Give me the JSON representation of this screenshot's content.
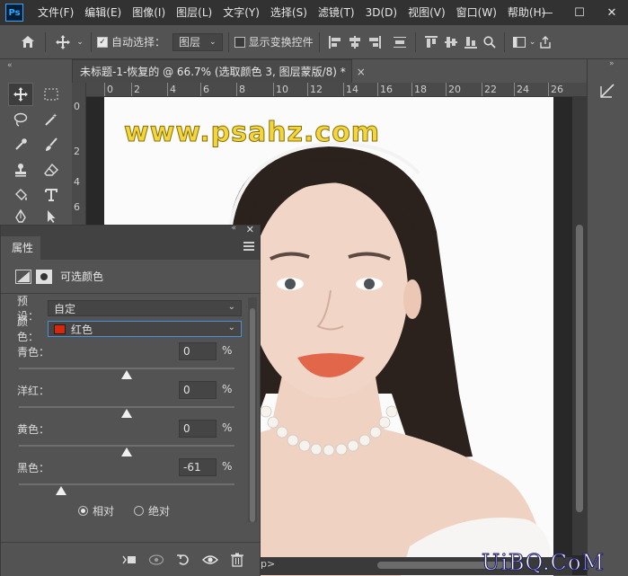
{
  "app": {
    "logo_text": "Ps",
    "menus": [
      "文件(F)",
      "编辑(E)",
      "图像(I)",
      "图层(L)",
      "文字(Y)",
      "选择(S)",
      "滤镜(T)",
      "3D(D)",
      "视图(V)",
      "窗口(W)",
      "帮助(H)"
    ],
    "window_controls": {
      "minimize": "—",
      "maximize": "☐",
      "close": "✕"
    }
  },
  "options_bar": {
    "auto_select_label": "自动选择：",
    "auto_select_checked": true,
    "auto_select_target": "图层",
    "show_transform_label": "显示变换控件",
    "show_transform_checked": false
  },
  "document": {
    "tab_title": "未标题-1-恢复的 @ 66.7% (选取颜色 3, 图层蒙版/8) *",
    "close_glyph": "×",
    "ruler_h_ticks": [
      "0",
      "2",
      "4",
      "6",
      "8",
      "10",
      "12",
      "14",
      "16",
      "18",
      "20",
      "22",
      "24",
      "26"
    ],
    "ruler_v_ticks": [
      "0",
      "2",
      "4",
      "6"
    ],
    "watermark_text": "www.psahz.com",
    "status_fragment": "p>"
  },
  "properties_panel": {
    "tab_label": "属性",
    "title": "可选颜色",
    "preset_label": "预设：",
    "preset_value": "自定",
    "color_label": "颜色：",
    "color_value": "红色",
    "color_swatch": "#d7280b",
    "sliders": [
      {
        "label": "青色：",
        "value": "0",
        "unit": "%",
        "percent": 0
      },
      {
        "label": "洋红：",
        "value": "0",
        "unit": "%",
        "percent": 0
      },
      {
        "label": "黄色：",
        "value": "0",
        "unit": "%",
        "percent": 0
      },
      {
        "label": "黑色：",
        "value": "-61",
        "unit": "%",
        "percent": -61
      }
    ],
    "method_relative": "相对",
    "method_absolute": "绝对",
    "method_selected": "relative"
  },
  "site_watermark": "UiBQ.CoM"
}
